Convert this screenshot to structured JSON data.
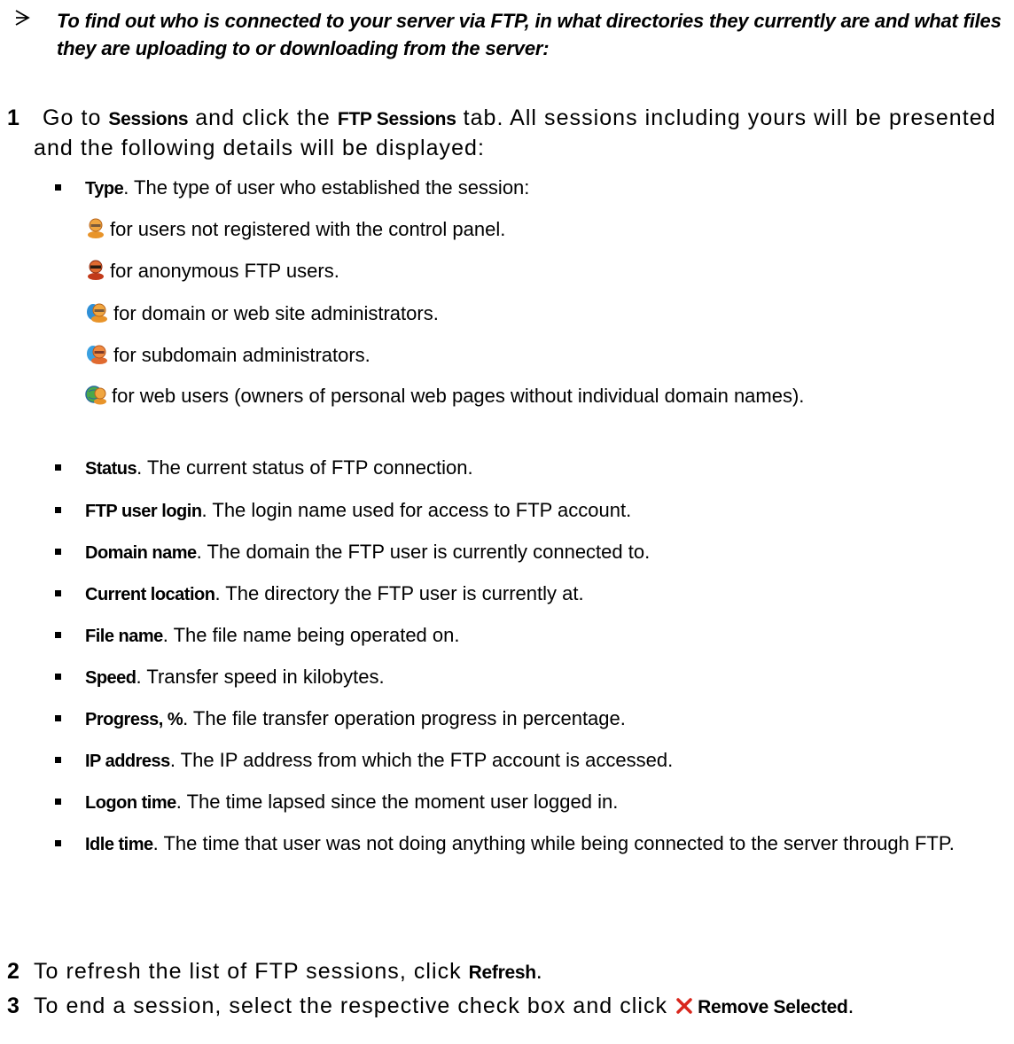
{
  "intro": {
    "text": "To find out who is connected to your server via FTP, in what directories they currently are and what files they are uploading to or downloading from the server:"
  },
  "step1": {
    "number": "1",
    "pre1": "Go to ",
    "kw1": "Sessions",
    "mid1": " and click the ",
    "kw2": "FTP Sessions",
    "post1": " tab. All sessions including yours will be presented and the following details will be displayed:"
  },
  "type_bullet": {
    "term": "Type",
    "desc": ". The type of user who established the session:"
  },
  "user_types": [
    {
      "icon": "unregistered-user-icon",
      "text": "for users not registered with the control panel."
    },
    {
      "icon": "anonymous-user-icon",
      "text": "for anonymous FTP users."
    },
    {
      "icon": "domain-admin-icon",
      "text": "for domain or web site administrators."
    },
    {
      "icon": "subdomain-admin-icon",
      "text": "for subdomain administrators."
    },
    {
      "icon": "web-user-icon",
      "text": "for web users (owners of personal web pages without individual domain names)."
    }
  ],
  "details": [
    {
      "term": "Status",
      "desc": ". The current status of FTP connection."
    },
    {
      "term": "FTP user login",
      "desc": ". The login name used for access to FTP account."
    },
    {
      "term": "Domain name",
      "desc": ". The domain the FTP user is currently connected to."
    },
    {
      "term": "Current location",
      "desc": ". The directory the FTP user is currently at."
    },
    {
      "term": "File name",
      "desc": ". The file name being operated on."
    },
    {
      "term": "Speed",
      "desc": ". Transfer speed in kilobytes."
    },
    {
      "term": "Progress, %",
      "desc": ". The file transfer operation progress in percentage."
    },
    {
      "term": "IP address",
      "desc": ". The IP address from which the FTP account is accessed."
    },
    {
      "term": "Logon time",
      "desc": ". The time lapsed since the moment user logged in."
    },
    {
      "term": "Idle time",
      "desc": ". The time that user was not doing anything while being connected to the server through FTP."
    }
  ],
  "step2": {
    "number": "2",
    "pre": "To refresh the list of FTP sessions, click ",
    "kw": "Refresh",
    "post": "."
  },
  "step3": {
    "number": "3",
    "pre": "To end a session, select the respective check box and click ",
    "icon": "remove-x-icon",
    "kw": "Remove Selected",
    "post": "."
  },
  "colors": {
    "remove_x": "#d9261c",
    "user_orange": "#e8942a",
    "user_dark": "#8b2a12",
    "admin_blue": "#2f8fd6",
    "web_green": "#4aa84a"
  }
}
